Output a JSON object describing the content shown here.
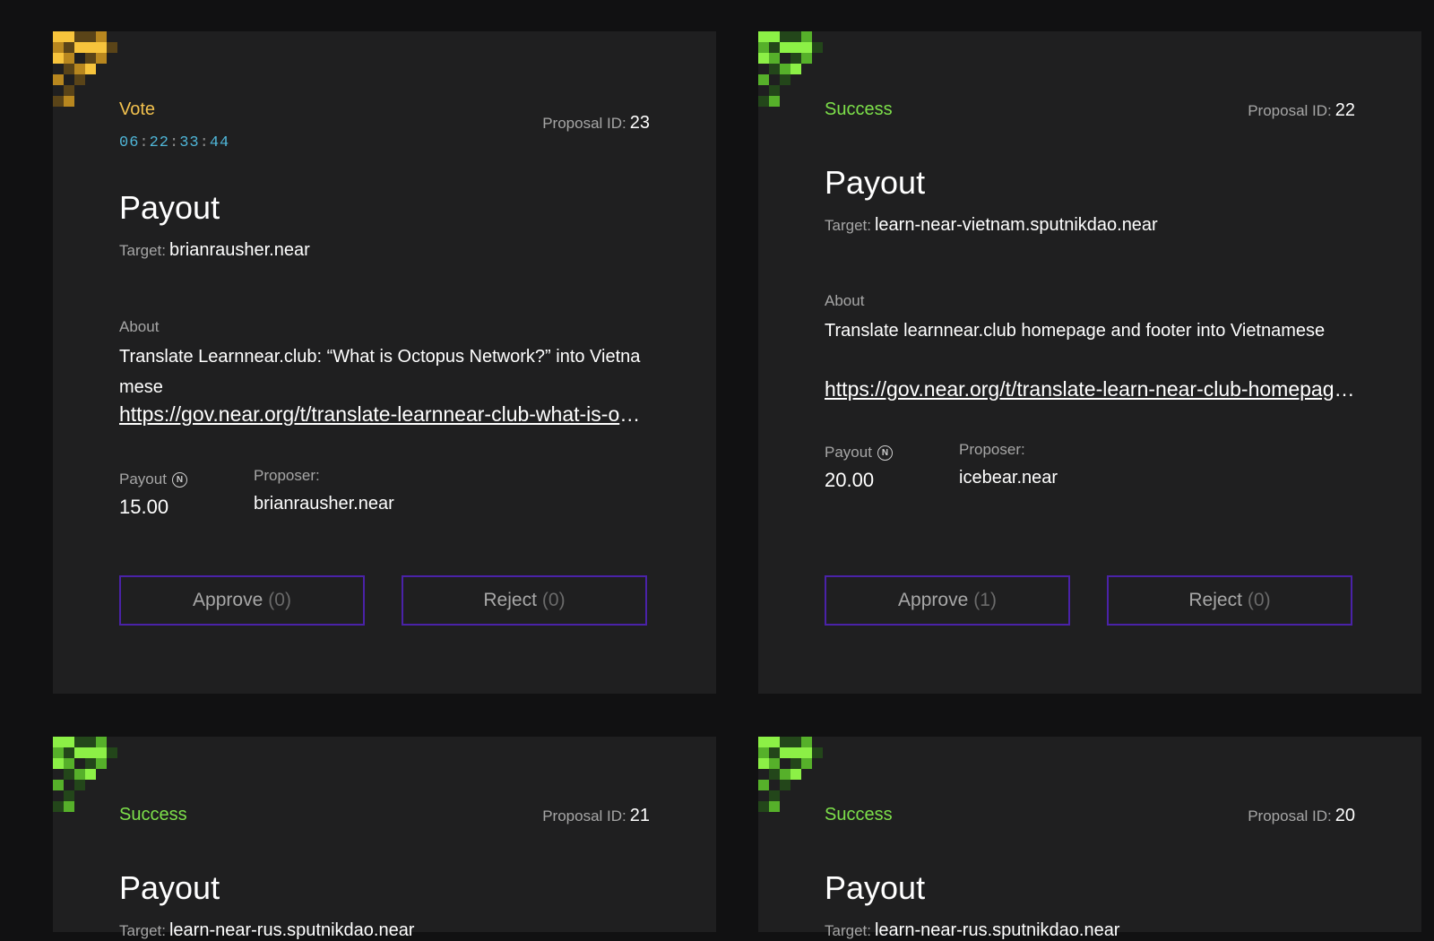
{
  "proposals": [
    {
      "status": "Vote",
      "timer": [
        "06",
        "22",
        "33",
        "44"
      ],
      "proposal_id_label": "Proposal ID:",
      "proposal_id": "23",
      "title": "Payout",
      "target_label": "Target:",
      "target": "brianrausher.near",
      "about_label": "About",
      "about": "Translate Learnnear.club: “What is Octopus Network?” into Vietnamese",
      "link": "https://gov.near.org/t/translate-learnnear-club-what-is-octopus-network-into-vietnamese",
      "payout_label": "Payout",
      "payout": "15.00",
      "proposer_label": "Proposer:",
      "proposer": "brianrausher.near",
      "approve_label": "Approve",
      "approve_count": "(0)",
      "reject_label": "Reject",
      "reject_count": "(0)"
    },
    {
      "status": "Success",
      "proposal_id_label": "Proposal ID:",
      "proposal_id": "22",
      "title": "Payout",
      "target_label": "Target:",
      "target": "learn-near-vietnam.sputnikdao.near",
      "about_label": "About",
      "about": "Translate learnnear.club homepage and footer into Vietnamese",
      "link": "https://gov.near.org/t/translate-learn-near-club-homepage-and-footer-into-vietnamese",
      "payout_label": "Payout",
      "payout": "20.00",
      "proposer_label": "Proposer:",
      "proposer": "icebear.near",
      "approve_label": "Approve",
      "approve_count": "(1)",
      "reject_label": "Reject",
      "reject_count": "(0)"
    },
    {
      "status": "Success",
      "proposal_id_label": "Proposal ID:",
      "proposal_id": "21",
      "title": "Payout",
      "target_label": "Target:",
      "target": "learn-near-rus.sputnikdao.near"
    },
    {
      "status": "Success",
      "proposal_id_label": "Proposal ID:",
      "proposal_id": "20",
      "title": "Payout",
      "target_label": "Target:",
      "target": "learn-near-rus.sputnikdao.near"
    }
  ],
  "icons": {
    "near": "near-token-icon",
    "status_pixels": "pixel-art-icon"
  },
  "colors": {
    "vote": "#f2c14e",
    "success": "#7de04a",
    "timer": "#4fb6d8",
    "button_border": "#4a22a8",
    "card_bg": "#1f1f20",
    "page_bg": "#111112"
  }
}
